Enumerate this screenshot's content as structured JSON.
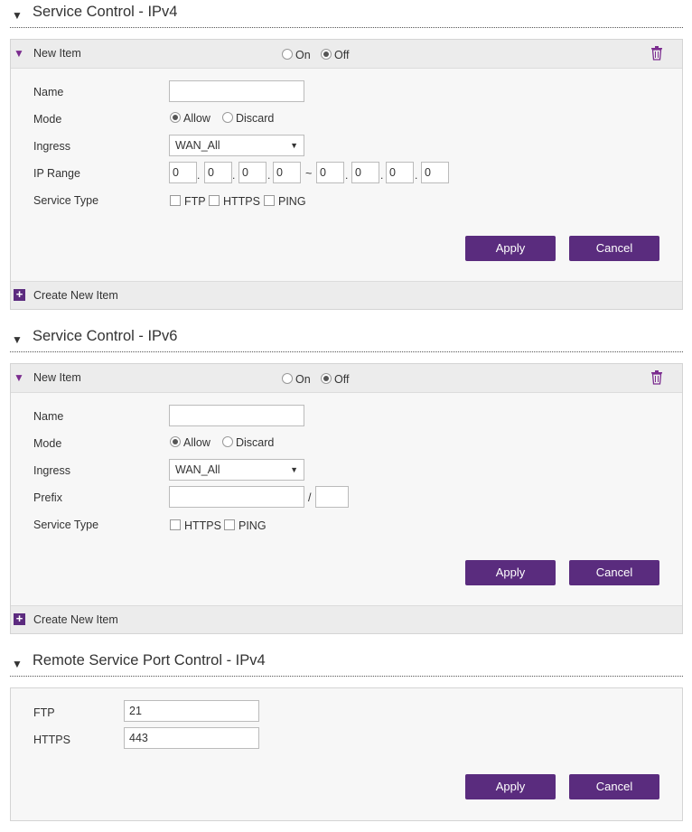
{
  "sections": [
    {
      "title": "Service Control - IPv4",
      "item_label": "New Item",
      "on_label": "On",
      "off_label": "Off",
      "fields": {
        "name_label": "Name",
        "mode_label": "Mode",
        "allow_label": "Allow",
        "discard_label": "Discard",
        "ingress_label": "Ingress",
        "ingress_value": "WAN_All",
        "range_label": "IP Range",
        "ip_start": [
          "0",
          "0",
          "0",
          "0"
        ],
        "ip_end": [
          "0",
          "0",
          "0",
          "0"
        ],
        "range_sep": "~",
        "service_label": "Service Type",
        "services": [
          "FTP",
          "HTTPS",
          "PING"
        ]
      },
      "apply": "Apply",
      "cancel": "Cancel",
      "create": "Create New Item"
    },
    {
      "title": "Service Control - IPv6",
      "item_label": "New Item",
      "on_label": "On",
      "off_label": "Off",
      "fields": {
        "name_label": "Name",
        "mode_label": "Mode",
        "allow_label": "Allow",
        "discard_label": "Discard",
        "ingress_label": "Ingress",
        "ingress_value": "WAN_All",
        "prefix_label": "Prefix",
        "prefix_sep": "/",
        "service_label": "Service Type",
        "services": [
          "HTTPS",
          "PING"
        ]
      },
      "apply": "Apply",
      "cancel": "Cancel",
      "create": "Create New Item"
    },
    {
      "title": "Remote Service Port Control - IPv4",
      "ftp_label": "FTP",
      "ftp_value": "21",
      "https_label": "HTTPS",
      "https_value": "443",
      "apply": "Apply",
      "cancel": "Cancel"
    }
  ],
  "icons": {
    "collapse": "triangle-down-icon",
    "item_toggle": "purple-triangle-icon",
    "delete": "trash-icon",
    "add": "plus-icon",
    "select_arrow": "chevron-down-icon"
  },
  "colors": {
    "accent": "#5a2c7e",
    "panel_bg": "#f7f7f7",
    "bar_bg": "#ececec"
  }
}
